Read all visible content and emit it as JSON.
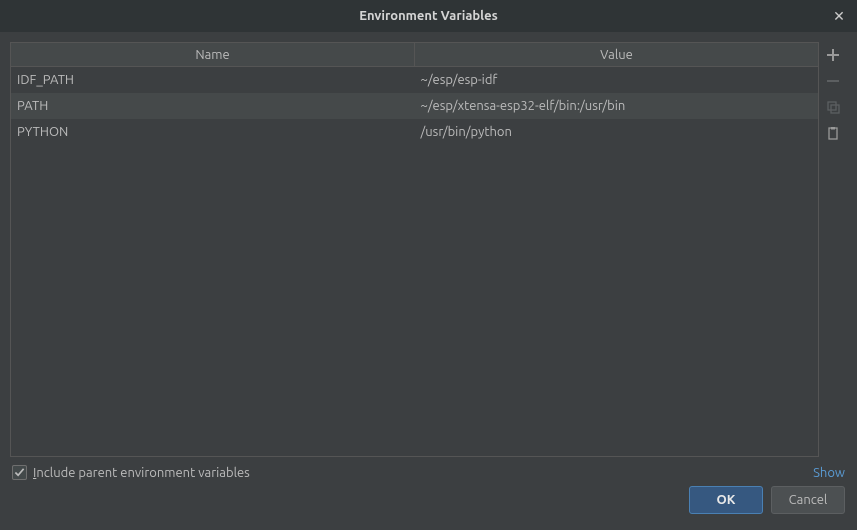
{
  "window": {
    "title": "Environment Variables"
  },
  "table": {
    "columns": {
      "name": "Name",
      "value": "Value"
    },
    "rows": [
      {
        "name": "IDF_PATH",
        "value": "~/esp/esp-idf"
      },
      {
        "name": "PATH",
        "value": "~/esp/xtensa-esp32-elf/bin:/usr/bin"
      },
      {
        "name": "PYTHON",
        "value": "/usr/bin/python"
      }
    ]
  },
  "footer": {
    "include_parent_checked": true,
    "include_parent_prefix": "I",
    "include_parent_rest": "nclude parent environment variables",
    "show_link": "Show"
  },
  "buttons": {
    "ok": "OK",
    "cancel": "Cancel"
  }
}
